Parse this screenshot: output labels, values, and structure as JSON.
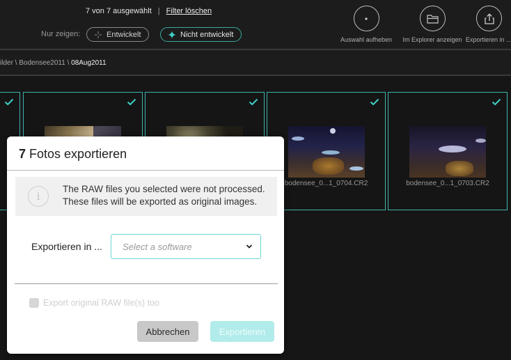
{
  "header": {
    "selection_text": "7 von 7 ausgewählt",
    "separator": "|",
    "clear_filter_label": "Filter löschen",
    "filter_label": "Nur zeigen:",
    "filters": [
      {
        "label": "Entwickelt",
        "icon": "sparkle-outline-icon",
        "active": false
      },
      {
        "label": "Nicht entwickelt",
        "icon": "sparkle-filled-icon",
        "active": true
      }
    ],
    "actions": [
      {
        "label": "Auswahl aufheben",
        "icon": "dot-circle-icon"
      },
      {
        "label": "Im Explorer anzeigen",
        "icon": "folder-icon"
      },
      {
        "label": "Exportieren in ...",
        "icon": "share-upload-icon"
      }
    ]
  },
  "breadcrumb": {
    "items": [
      "ilder",
      "Bodensee2011",
      "08Aug2011"
    ],
    "separator": " \\ "
  },
  "grid": {
    "cards": [
      {
        "filename": "",
        "selected": true,
        "thumb": "partial"
      },
      {
        "filename": "",
        "selected": true,
        "thumb": "warm-reef"
      },
      {
        "filename": "",
        "selected": true,
        "thumb": "dark-reef"
      },
      {
        "filename": "bodensee_0...1_0704.CR2",
        "selected": true,
        "thumb": "fish-school"
      },
      {
        "filename": "bodensee_0...1_0703.CR2",
        "selected": true,
        "thumb": "single-fish"
      }
    ]
  },
  "dialog": {
    "count": "7",
    "title": "Fotos exportieren",
    "info_icon": "info-icon",
    "info_line1": "The RAW files you selected were not processed.",
    "info_line2": "These files will be exported as original images.",
    "export_label": "Exportieren in ...",
    "select_placeholder": "Select a software",
    "checkbox_label": "Export original RAW file(s) too",
    "checkbox_checked": false,
    "checkbox_disabled": true,
    "cancel_label": "Abbrechen",
    "export_button_label": "Exportieren",
    "export_button_disabled": true
  },
  "colors": {
    "accent": "#3fb5ad",
    "accent_light": "#6ad8d2",
    "export_disabled": "#b2ecea"
  }
}
